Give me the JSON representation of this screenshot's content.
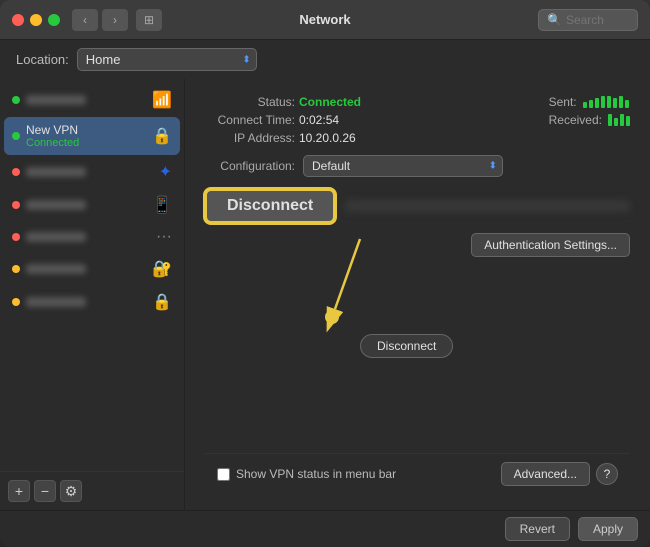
{
  "window": {
    "title": "Network"
  },
  "titlebar": {
    "search_placeholder": "Search"
  },
  "location": {
    "label": "Location:",
    "value": "Home"
  },
  "sidebar": {
    "items": [
      {
        "id": "item1",
        "dot": "green",
        "name": "",
        "subtitle": "",
        "icon": "wifi",
        "blurred": true
      },
      {
        "id": "item2",
        "dot": "green",
        "name": "New VPN",
        "subtitle": "Connected",
        "icon": "vpn",
        "active": true
      },
      {
        "id": "item3",
        "dot": "red",
        "name": "",
        "subtitle": "",
        "icon": "bluetooth",
        "blurred": true
      },
      {
        "id": "item4",
        "dot": "red",
        "name": "",
        "subtitle": "",
        "icon": "phone",
        "blurred": true
      },
      {
        "id": "item5",
        "dot": "red",
        "name": "",
        "subtitle": "",
        "icon": "dots",
        "blurred": true
      },
      {
        "id": "item6",
        "dot": "yellow",
        "name": "",
        "subtitle": "",
        "icon": "vpn2",
        "blurred": true
      },
      {
        "id": "item7",
        "dot": "yellow",
        "name": "",
        "subtitle": "",
        "icon": "lock",
        "blurred": true
      }
    ],
    "add_label": "+",
    "remove_label": "−",
    "gear_label": "⚙"
  },
  "detail": {
    "status_label": "Status:",
    "status_value": "Connected",
    "connect_time_label": "Connect Time:",
    "connect_time_value": "0:02:54",
    "ip_label": "IP Address:",
    "ip_value": "10.20.0.26",
    "sent_label": "Sent:",
    "received_label": "Received:",
    "config_label": "Configuration:",
    "config_value": "Default",
    "disconnect_btn": "Disconnect",
    "auth_settings_btn": "Authentication Settings...",
    "disconnect_callout": "Disconnect",
    "show_vpn_label": "Show VPN status in menu bar",
    "advanced_btn": "Advanced...",
    "help_btn": "?",
    "revert_btn": "Revert",
    "apply_btn": "Apply"
  }
}
